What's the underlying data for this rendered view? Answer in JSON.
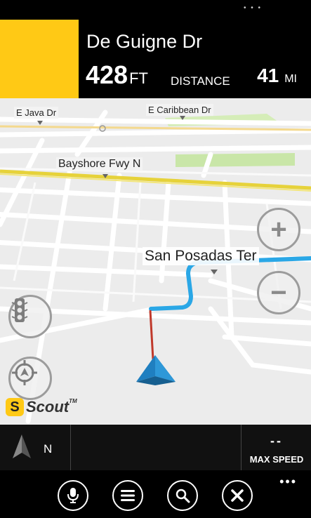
{
  "status_bar": {
    "dots": "• • •"
  },
  "header": {
    "street_name": "De Guigne Dr",
    "distance_value": "428",
    "distance_unit": "FT",
    "distance_label": "DISTANCE",
    "remaining_value": "41",
    "remaining_unit": "MI",
    "turn_box_color": "#ffc915"
  },
  "map": {
    "labels": {
      "java": "E Java Dr",
      "caribbean": "E Caribbean Dr",
      "bayshore": "Bayshore Fwy N",
      "san_posadas": "San Posadas Ter"
    },
    "route_color": "#2aa7e6",
    "track_color": "#c0392b",
    "zoom_in_label": "+",
    "zoom_out_label": "−",
    "logo_text": "Scout",
    "logo_letter": "S",
    "logo_tm": "TM"
  },
  "info_bar": {
    "compass_heading": "N",
    "max_speed_value": "--",
    "max_speed_label": "MAX SPEED"
  },
  "app_bar": {
    "buttons": [
      "microphone-icon",
      "menu-icon",
      "search-icon",
      "close-icon"
    ],
    "more_label": "•••"
  }
}
